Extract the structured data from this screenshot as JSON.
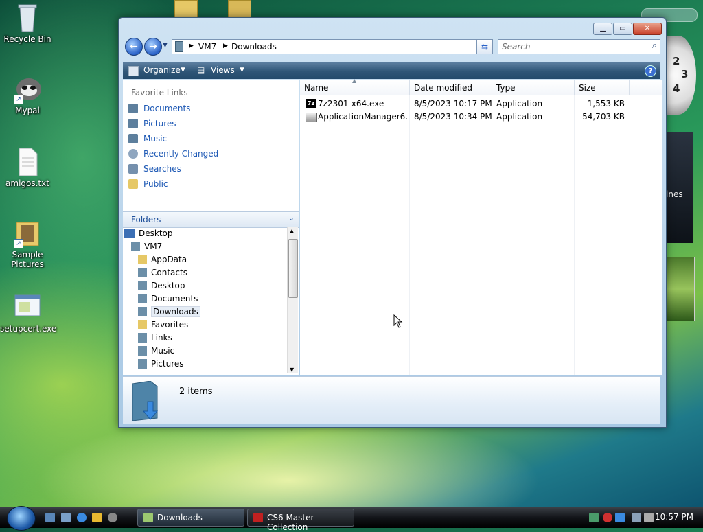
{
  "desktop": {
    "icons": [
      {
        "label": "Recycle Bin"
      },
      {
        "label": "Mypal"
      },
      {
        "label": "amigos.txt"
      },
      {
        "label": "Sample Pictures"
      },
      {
        "label": "setupcert.exe"
      }
    ],
    "gadget_clock_numbers": [
      "2",
      "3",
      "4"
    ],
    "gadget_text": "ines"
  },
  "window": {
    "breadcrumb": [
      "VM7",
      "Downloads"
    ],
    "search_placeholder": "Search",
    "toolbar": {
      "organize": "Organize",
      "views": "Views",
      "help": "?"
    },
    "favorite_links": {
      "title": "Favorite Links",
      "items": [
        "Documents",
        "Pictures",
        "Music",
        "Recently Changed",
        "Searches",
        "Public"
      ]
    },
    "folders": {
      "title": "Folders",
      "tree": [
        "Desktop",
        "VM7",
        "AppData",
        "Contacts",
        "Desktop",
        "Documents",
        "Downloads",
        "Favorites",
        "Links",
        "Music",
        "Pictures"
      ],
      "selected": "Downloads"
    },
    "columns": [
      "Name",
      "Date modified",
      "Type",
      "Size"
    ],
    "files": [
      {
        "name": "7z2301-x64.exe",
        "date": "8/5/2023 10:17 PM",
        "type": "Application",
        "size": "1,553 KB"
      },
      {
        "name": "ApplicationManager6....",
        "date": "8/5/2023 10:34 PM",
        "type": "Application",
        "size": "54,703 KB"
      }
    ],
    "details": {
      "count": "2 items"
    }
  },
  "taskbar": {
    "tasks": [
      {
        "label": "Downloads",
        "active": true
      },
      {
        "label": "CS6 Master Collection",
        "active": false
      }
    ],
    "clock": "10:57 PM"
  }
}
